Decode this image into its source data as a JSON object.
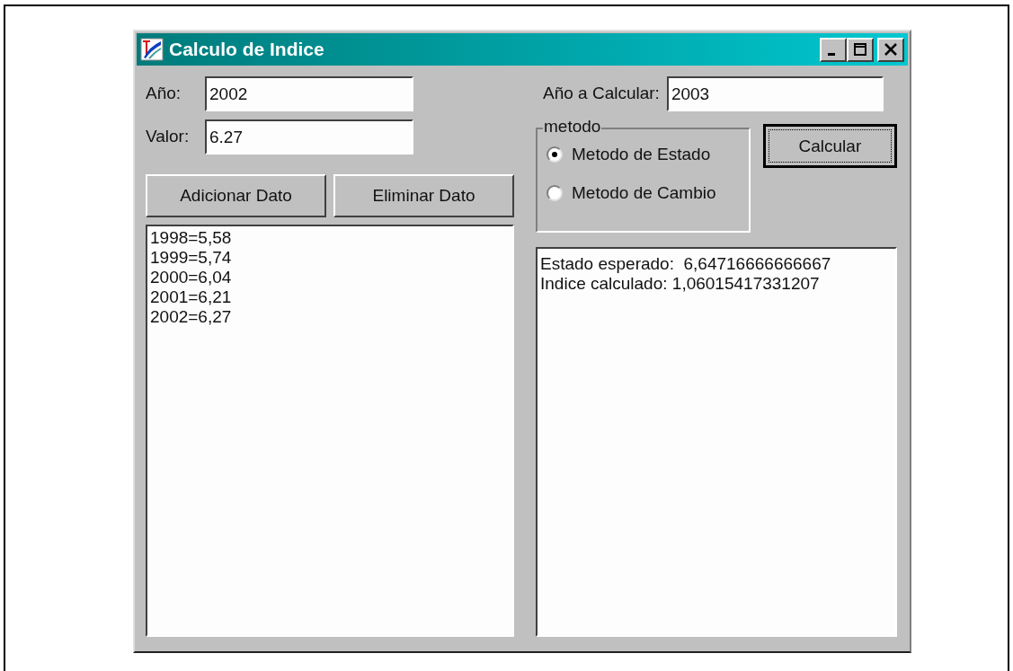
{
  "window": {
    "title": "Calculo de Indice"
  },
  "year_field": {
    "label": "Año:",
    "value": "2002"
  },
  "value_field": {
    "label": "Valor:",
    "value": "6.27"
  },
  "buttons": [
    {
      "label": "Adicionar Dato"
    },
    {
      "label": "Eliminar Dato"
    }
  ],
  "data_list": {
    "items": [
      "1998=5,58",
      "1999=5,74",
      "2000=6,04",
      "2001=6,21",
      "2002=6,27"
    ]
  },
  "target_year_field": {
    "label": "Año a Calcular:",
    "value": "2003"
  },
  "method_group": {
    "title": "metodo",
    "options": [
      {
        "label": "Metodo de Estado",
        "selected": true
      },
      {
        "label": "Metodo de Cambio",
        "selected": false
      }
    ]
  },
  "calculate_button": {
    "label": "Calcular",
    "default": true
  },
  "results": {
    "lines": [
      "Estado esperado:  6,64716666666667",
      "Indice calculado: 1,06015417331207"
    ]
  }
}
